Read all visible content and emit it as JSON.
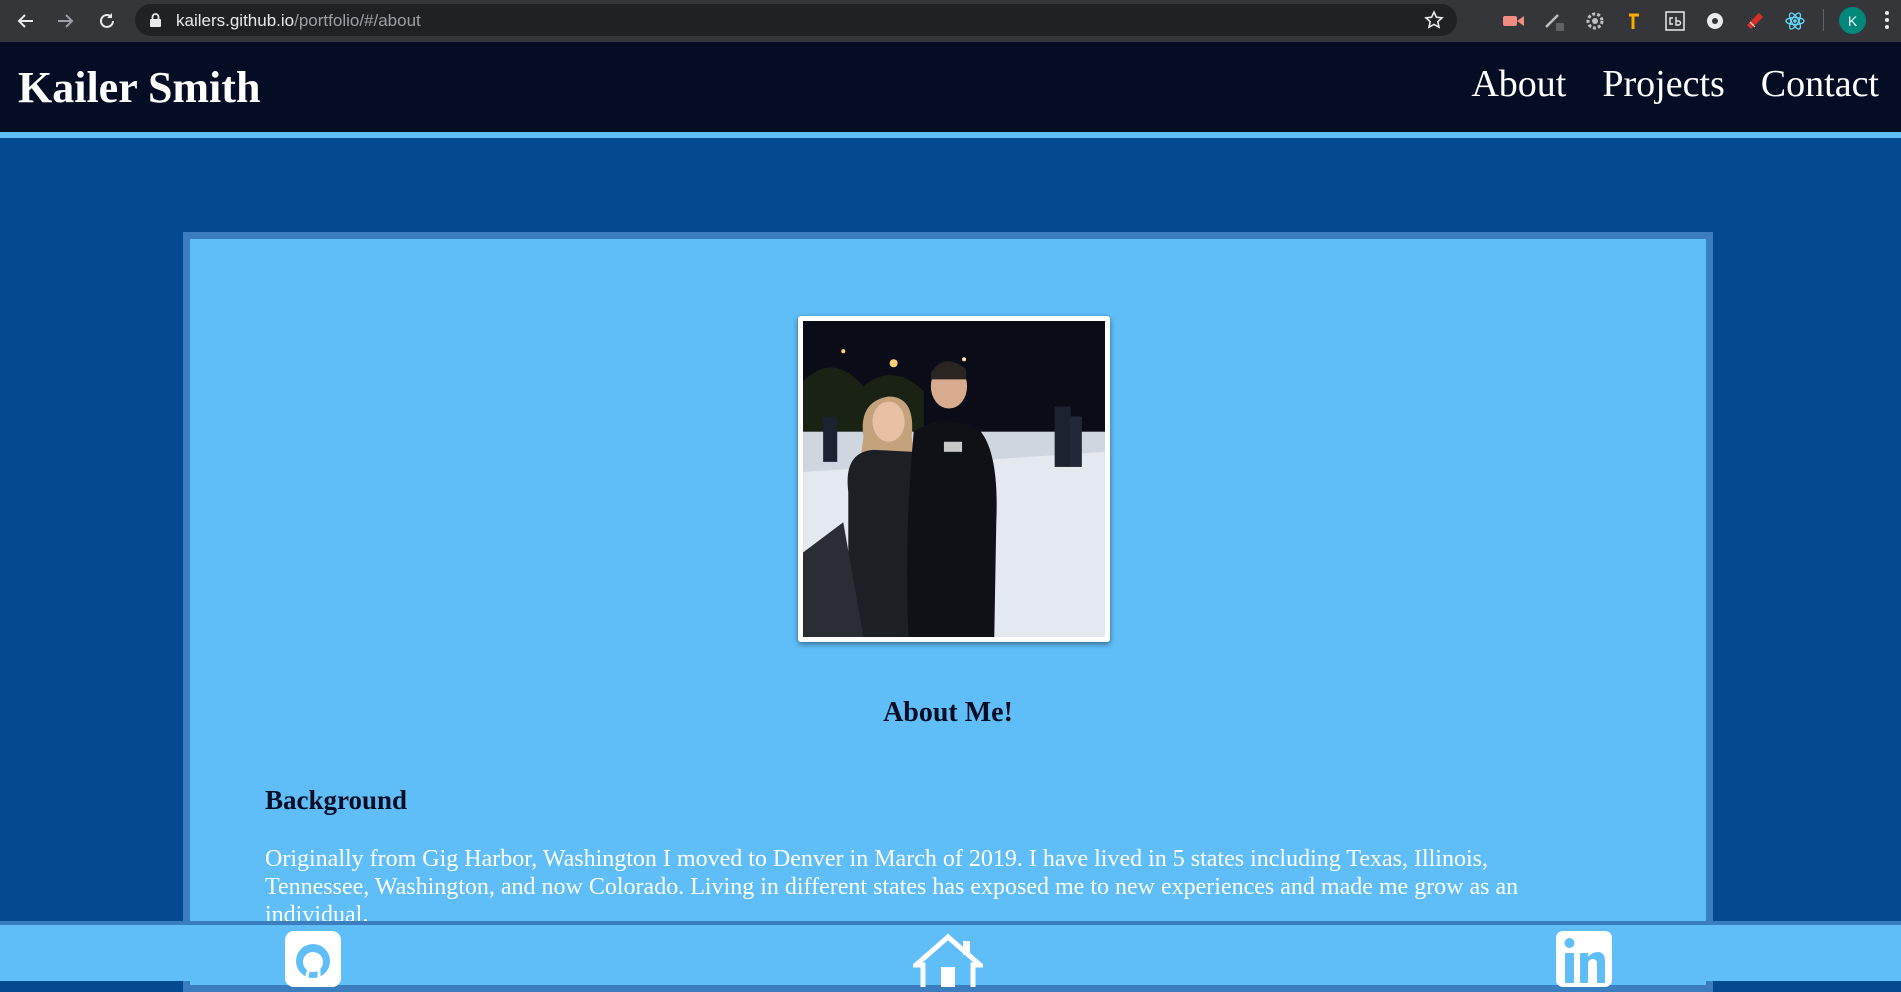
{
  "browser": {
    "url_host": "kailers.github.io",
    "url_path": "/portfolio/#/about",
    "back_icon": "arrow-left-icon",
    "forward_icon": "arrow-right-icon",
    "reload_icon": "reload-icon",
    "lock_icon": "lock-icon",
    "bookmark_icon": "star-icon",
    "profile_initial": "K",
    "menu_icon": "kebab-menu-icon"
  },
  "header": {
    "brand": "Kailer Smith",
    "nav": [
      "About",
      "Projects",
      "Contact"
    ]
  },
  "about": {
    "photo_alt": "photo-of-couple-ice-skating",
    "heading": "About Me!",
    "section_title": "Background",
    "text": "Originally from Gig Harbor, Washington I moved to Denver in March of 2019. I have lived in 5 states including Texas, Illinois, Tennessee, Washington, and now Colorado. Living in different states has exposed me to new experiences and made me grow as an individual."
  },
  "footer": {
    "icons": [
      "github-icon",
      "home-icon",
      "linkedin-icon"
    ]
  },
  "colors": {
    "page_bg": "#034a91",
    "header_bg": "#050d24",
    "accent": "#5fbef8",
    "card_border": "#3b7ec0"
  }
}
